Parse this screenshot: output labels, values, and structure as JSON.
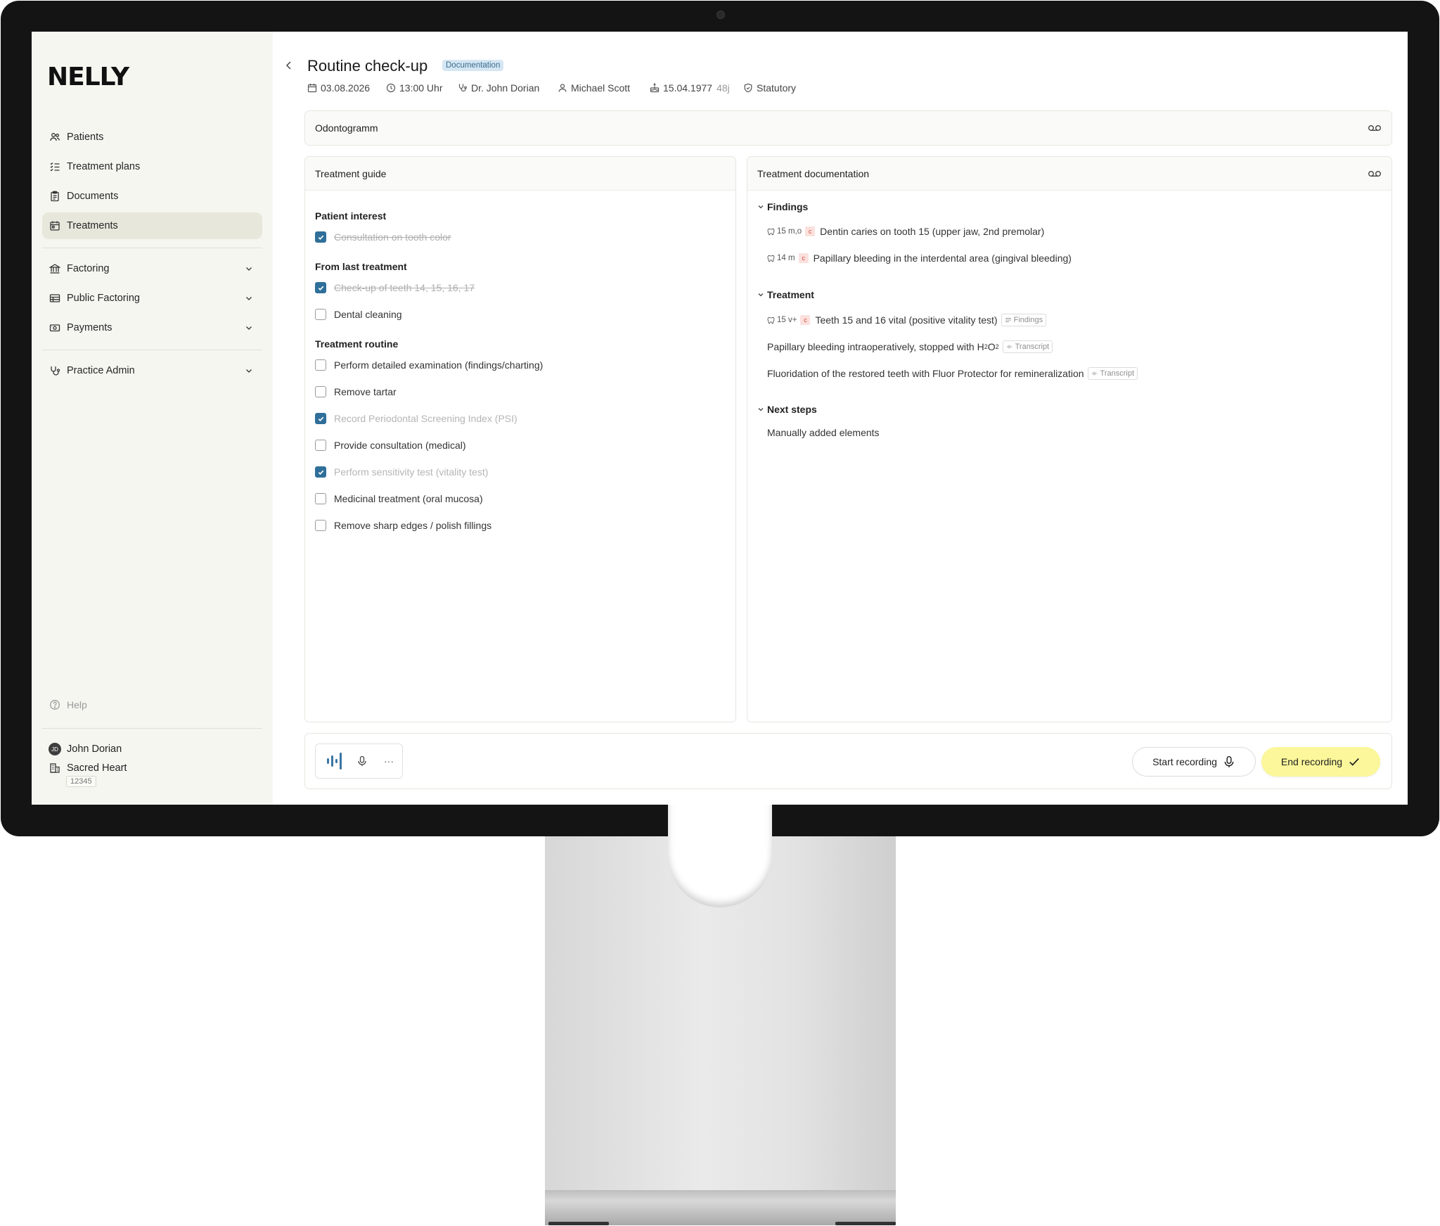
{
  "sidebar": {
    "logo": "NELLY",
    "items": [
      {
        "label": "Patients"
      },
      {
        "label": "Treatment plans"
      },
      {
        "label": "Documents"
      },
      {
        "label": "Treatments"
      },
      {
        "label": "Factoring"
      },
      {
        "label": "Public Factoring"
      },
      {
        "label": "Payments"
      },
      {
        "label": "Practice Admin"
      }
    ],
    "help": "Help",
    "user": {
      "initials": "JD",
      "name": "John Dorian"
    },
    "practice": {
      "name": "Sacred Heart",
      "id": "12345"
    }
  },
  "header": {
    "title": "Routine check-up",
    "badge": "Documentation",
    "date": "03.08.2026",
    "time": "13:00 Uhr",
    "doctor": "Dr. John Dorian",
    "patient": "Michael Scott",
    "birthdate": "15.04.1977",
    "age": "48j",
    "insurance": "Statutory"
  },
  "odontogram": {
    "title": "Odontogramm"
  },
  "guide": {
    "title": "Treatment guide",
    "sections": [
      {
        "title": "Patient interest",
        "items": [
          {
            "label": "Consultation on tooth color",
            "checked": true,
            "strike": true
          }
        ]
      },
      {
        "title": "From last treatment",
        "items": [
          {
            "label": "Check-up of teeth 14, 15, 16, 17",
            "checked": true,
            "strike": true
          },
          {
            "label": "Dental cleaning",
            "checked": false,
            "strike": false
          }
        ]
      },
      {
        "title": "Treatment routine",
        "items": [
          {
            "label": "Perform detailed examination (findings/charting)",
            "checked": false
          },
          {
            "label": "Remove tartar",
            "checked": false
          },
          {
            "label": "Record Periodontal Screening Index (PSI)",
            "checked": true
          },
          {
            "label": "Provide consultation (medical)",
            "checked": false
          },
          {
            "label": "Perform sensitivity test (vitality test)",
            "checked": true
          },
          {
            "label": "Medicinal treatment (oral mucosa)",
            "checked": false
          },
          {
            "label": "Remove sharp edges / polish fillings",
            "checked": false
          }
        ]
      }
    ]
  },
  "documentation": {
    "title": "Treatment documentation",
    "findings": {
      "title": "Findings",
      "items": [
        {
          "tooth": "15 m,o",
          "code": "c",
          "text": "Dentin caries on tooth 15 (upper jaw, 2nd premolar)"
        },
        {
          "tooth": "14 m",
          "code": "c",
          "text": "Papillary bleeding in the interdental area (gingival bleeding)"
        }
      ]
    },
    "treatment": {
      "title": "Treatment",
      "items": [
        {
          "tooth": "15 v+",
          "code": "c",
          "text": "Teeth 15 and 16 vital (positive vitality test)",
          "source": "Findings"
        },
        {
          "text_pre": "Papillary bleeding intraoperatively, stopped with H",
          "sub": "2",
          "mid": "O",
          "sub2": "2",
          "source": "Transcript"
        },
        {
          "text": "Fluoridation of the restored teeth with Fluor Protector for remineralization",
          "source": "Transcript"
        }
      ]
    },
    "next_steps": {
      "title": "Next steps",
      "items": [
        {
          "text": "Manually added elements"
        }
      ]
    }
  },
  "recorder": {
    "start_label": "Start recording",
    "end_label": "End recording",
    "more": "···"
  },
  "colors": {
    "accent": "#2f6f9a",
    "end_button": "#fbf79a",
    "badge_bg": "#d5e6f3",
    "sidebar_bg": "#f6f6f1"
  }
}
